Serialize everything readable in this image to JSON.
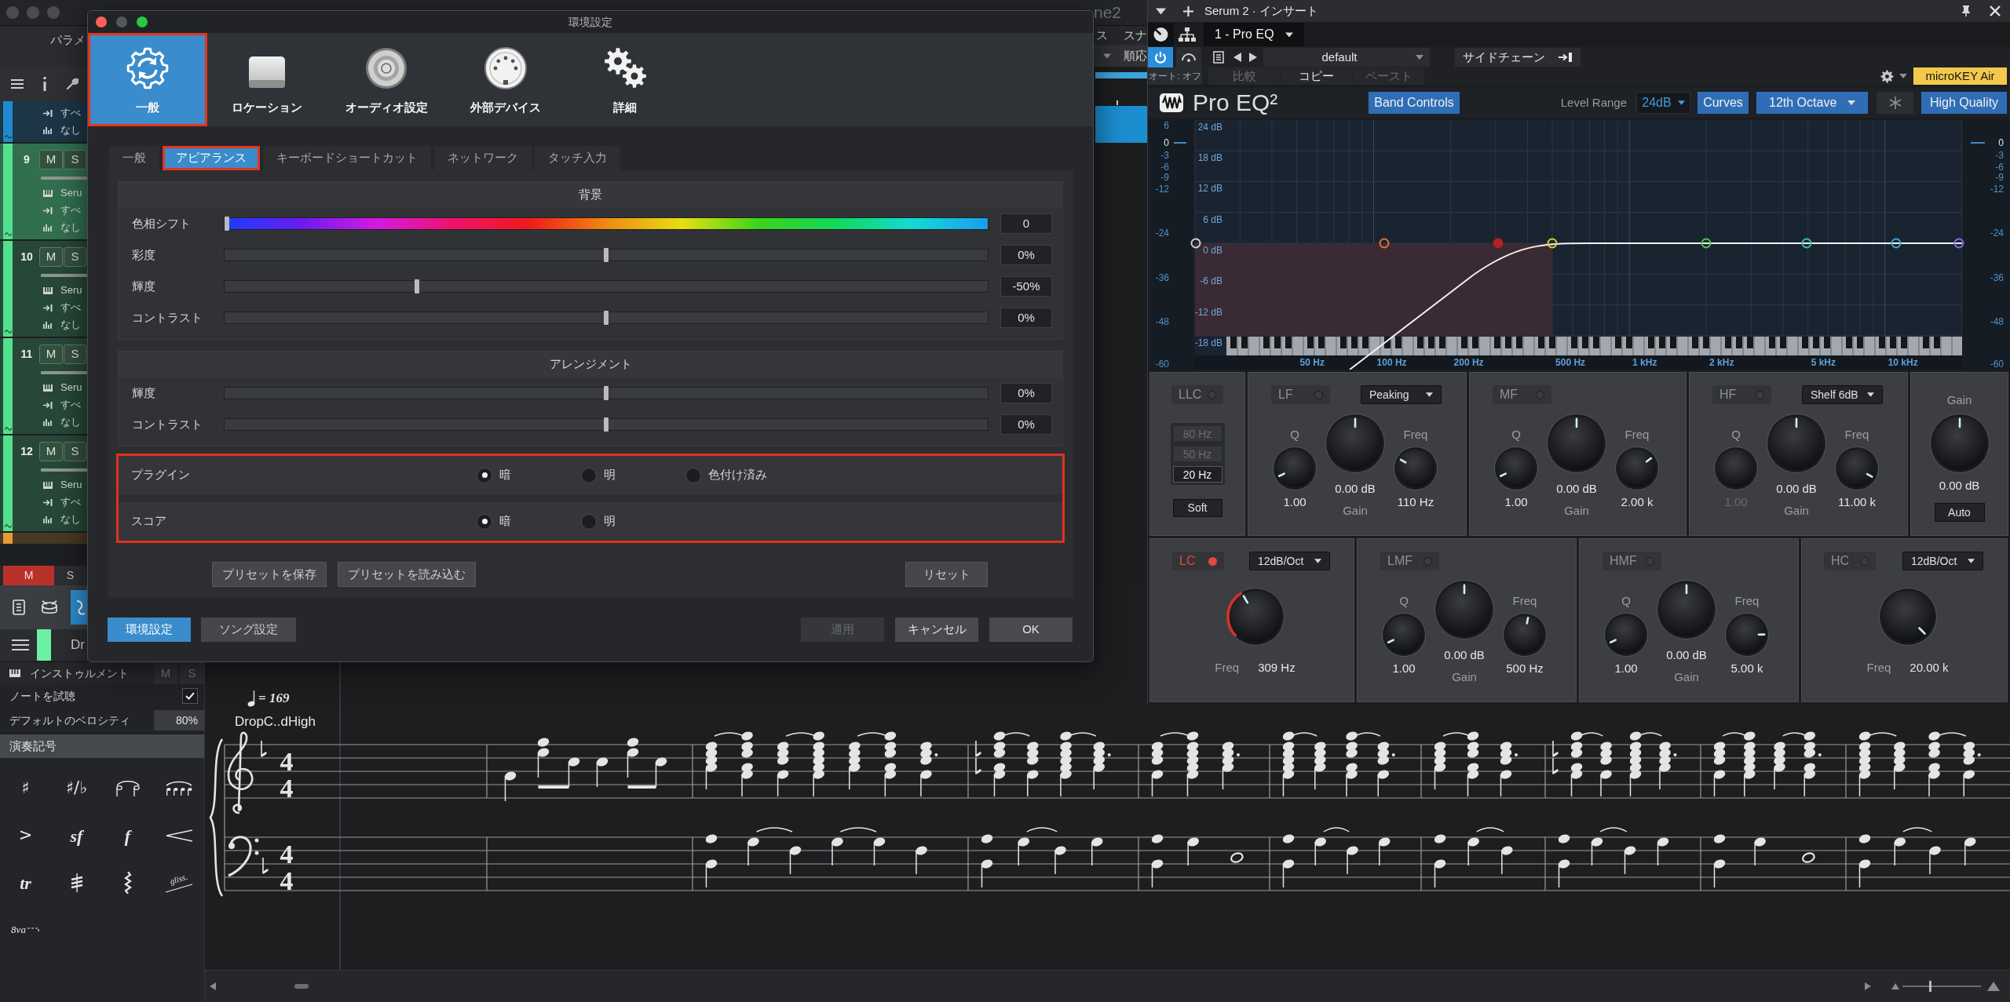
{
  "daw": {
    "title_fragment": "ne2",
    "header_fragments": [
      "ス",
      "スナ"
    ],
    "mode_fragment": "順応",
    "panel_tab": "パラメ"
  },
  "tracks": [
    {
      "color": "#1f8ad2",
      "selected": false,
      "rows": [
        {
          "kind": "input",
          "text": "すべ"
        },
        {
          "kind": "output",
          "text": "なし"
        }
      ]
    },
    {
      "number": "9",
      "color": "#52e08e",
      "selected": true,
      "mute": "M",
      "solo": "S",
      "rows": [
        {
          "kind": "instrument",
          "text": "Seru"
        },
        {
          "kind": "input",
          "text": "すべ"
        },
        {
          "kind": "output",
          "text": "なし"
        }
      ]
    },
    {
      "number": "10",
      "color": "#52e08e",
      "selected": false,
      "mute": "M",
      "solo": "S",
      "rows": [
        {
          "kind": "instrument",
          "text": "Seru"
        },
        {
          "kind": "input",
          "text": "すべ"
        },
        {
          "kind": "output",
          "text": "なし"
        }
      ]
    },
    {
      "number": "11",
      "color": "#52e08e",
      "selected": false,
      "mute": "M",
      "solo": "S",
      "rows": [
        {
          "kind": "instrument",
          "text": "Seru"
        },
        {
          "kind": "input",
          "text": "すべ"
        },
        {
          "kind": "output",
          "text": "なし"
        }
      ]
    },
    {
      "number": "12",
      "color": "#52e08e",
      "selected": false,
      "mute": "M",
      "solo": "S",
      "rows": [
        {
          "kind": "instrument",
          "text": "Seru"
        },
        {
          "kind": "input",
          "text": "すべ"
        },
        {
          "kind": "output",
          "text": "なし"
        }
      ]
    },
    {
      "color": "#e89a35",
      "selected": false
    }
  ],
  "track_buttons": [
    {
      "label": "M",
      "on": true
    },
    {
      "label": "S",
      "on": false
    }
  ],
  "editor": {
    "instrument": {
      "name": "Dr",
      "color": "#6cf0a6"
    },
    "instrument_row": {
      "label": "インストゥルメント",
      "mute": "M",
      "solo": "S"
    },
    "audition": {
      "label": "ノートを試聴",
      "checked": true
    },
    "velocity": {
      "label": "デフォルトのベロシティ",
      "value": "80%"
    },
    "palette": {
      "title": "演奏記号",
      "items": [
        {
          "kind": "glyph",
          "text": "♯"
        },
        {
          "kind": "glyph",
          "text": "♯/♭"
        },
        {
          "kind": "fermata"
        },
        {
          "kind": "tuplet"
        },
        {
          "kind": "glyph",
          "text": ">"
        },
        {
          "kind": "dynamic",
          "text": "sf"
        },
        {
          "kind": "dynamic",
          "text": "f"
        },
        {
          "kind": "crescendo"
        },
        {
          "kind": "dynamic",
          "text": "tr"
        },
        {
          "kind": "tremolo"
        },
        {
          "kind": "arpeggio"
        },
        {
          "kind": "gliss",
          "text": "gliss."
        },
        {
          "kind": "octave",
          "text": "8va"
        }
      ]
    }
  },
  "score": {
    "tempo": "= 169",
    "track_name": "DropC..dHigh",
    "staves": [
      {
        "kind": "treble",
        "time": [
          "4",
          "4"
        ]
      },
      {
        "kind": "bass",
        "time": [
          "4",
          "4"
        ]
      }
    ],
    "zoom": {
      "level": 0.35
    }
  },
  "preferences": {
    "title": "環境設定",
    "categories": [
      {
        "kind": "general",
        "label": "一般",
        "selected": true,
        "highlighted": true
      },
      {
        "kind": "location",
        "label": "ロケーション",
        "selected": false,
        "highlighted": false
      },
      {
        "kind": "audio",
        "label": "オーディオ設定",
        "selected": false,
        "highlighted": false
      },
      {
        "kind": "devices",
        "label": "外部デバイス",
        "selected": false,
        "highlighted": false
      },
      {
        "kind": "advanced",
        "label": "詳細",
        "selected": false,
        "highlighted": false
      }
    ],
    "subtabs": [
      {
        "label": "一般",
        "selected": false,
        "highlighted": false
      },
      {
        "label": "アピアランス",
        "selected": true,
        "highlighted": true
      },
      {
        "label": "キーボードショートカット",
        "selected": false,
        "highlighted": false
      },
      {
        "label": "ネットワーク",
        "selected": false,
        "highlighted": false
      },
      {
        "label": "タッチ入力",
        "selected": false,
        "highlighted": false
      }
    ],
    "sections": [
      {
        "title": "背景",
        "sliders": [
          {
            "kind": "hue",
            "label": "色相シフト",
            "level": 0,
            "value": "0"
          },
          {
            "kind": "plain",
            "label": "彩度",
            "level": 0.5,
            "value": "0%"
          },
          {
            "kind": "plain",
            "label": "輝度",
            "level": 0.25,
            "value": "-50%"
          },
          {
            "kind": "plain",
            "label": "コントラスト",
            "level": 0.5,
            "value": "0%"
          }
        ]
      },
      {
        "title": "アレンジメント",
        "sliders": [
          {
            "kind": "plain",
            "label": "輝度",
            "level": 0.5,
            "value": "0%"
          },
          {
            "kind": "plain",
            "label": "コントラスト",
            "level": 0.5,
            "value": "0%"
          }
        ]
      }
    ],
    "themes": {
      "highlighted": true,
      "rows": [
        {
          "label": "プラグイン",
          "options": [
            {
              "label": "暗",
              "selected": true
            },
            {
              "label": "明",
              "selected": false
            },
            {
              "label": "色付け済み",
              "selected": false
            }
          ]
        },
        {
          "label": "スコア",
          "options": [
            {
              "label": "暗",
              "selected": true
            },
            {
              "label": "明",
              "selected": false
            }
          ]
        }
      ]
    },
    "preset_buttons": [
      "プリセットを保存",
      "プリセットを読み込む"
    ],
    "reset_button": "リセット",
    "footer_tabs": [
      {
        "label": "環境設定",
        "selected": true
      },
      {
        "label": "ソング設定",
        "selected": false
      }
    ],
    "footer_buttons": [
      {
        "label": "適用",
        "disabled": true
      },
      {
        "label": "キャンセル",
        "disabled": false
      },
      {
        "label": "OK",
        "disabled": false
      }
    ]
  },
  "plugin": {
    "title": "Serum 2 · インサート",
    "insert": "1 - Pro EQ",
    "power_on": true,
    "preset": "default",
    "sidechain": "サイドチェーン",
    "auto": "オート: オフ",
    "edit_buttons": [
      {
        "label": "比較",
        "disabled": true
      },
      {
        "label": "コピー",
        "disabled": false
      },
      {
        "label": "ペースト",
        "disabled": true
      }
    ],
    "device": "microKEY Air",
    "eq": {
      "name": "Pro EQ²",
      "band_controls": {
        "label": "Band Controls",
        "on": true
      },
      "level_range_label": "Level Range",
      "level_range": "24dB",
      "curves": {
        "label": "Curves",
        "on": true
      },
      "resolution": "12th Octave",
      "high_quality": {
        "label": "High Quality",
        "on": true
      },
      "graph": {
        "left_scale": [
          "6",
          "0",
          "-3",
          "-6",
          "-9",
          "-12",
          "-24",
          "-36",
          "-48",
          "-60"
        ],
        "right_scale": [
          "0",
          "-3",
          "-6",
          "-9",
          "-12",
          "-24",
          "-36",
          "-48",
          "-60"
        ],
        "db_labels": [
          "24 dB",
          "18 dB",
          "12 dB",
          "6 dB",
          "0 dB",
          "-6 dB",
          "-12 dB",
          "-18 dB"
        ],
        "freq_labels": [
          "50 Hz",
          "100 Hz",
          "200 Hz",
          "500 Hz",
          "1 kHz",
          "2 kHz",
          "5 kHz",
          "10 kHz"
        ],
        "handles": [
          {
            "color": "#d0d0d0",
            "on": false
          },
          {
            "color": "#e8742c",
            "on": false
          },
          {
            "color": "#b52024",
            "on": true
          },
          {
            "color": "#e0d030",
            "on": false
          },
          {
            "color": "#4ec94e",
            "on": false
          },
          {
            "color": "#3cc4a8",
            "on": false
          },
          {
            "color": "#3aa8d8",
            "on": false
          },
          {
            "color": "#8a6ae0",
            "on": false
          }
        ]
      }
    },
    "bands_top": [
      {
        "kind": "llc",
        "name": "LLC",
        "on": false,
        "options": [
          {
            "label": "80 Hz",
            "selected": false
          },
          {
            "label": "50 Hz",
            "selected": false
          },
          {
            "label": "20 Hz",
            "selected": true
          }
        ],
        "button": "Soft"
      },
      {
        "kind": "band",
        "name": "LF",
        "on": false,
        "mode": "Peaking",
        "q": {
          "label": "Q",
          "value": "1.00",
          "disabled": false
        },
        "gain": {
          "label": "Gain",
          "value": "0.00 dB",
          "disabled": false
        },
        "freq": {
          "label": "Freq",
          "value": "110 Hz",
          "disabled": false
        }
      },
      {
        "kind": "band",
        "name": "MF",
        "on": false,
        "q": {
          "label": "Q",
          "value": "1.00",
          "disabled": false
        },
        "gain": {
          "label": "Gain",
          "value": "0.00 dB",
          "disabled": false
        },
        "freq": {
          "label": "Freq",
          "value": "2.00 k",
          "disabled": false
        }
      },
      {
        "kind": "band",
        "name": "HF",
        "on": false,
        "mode": "Shelf 6dB",
        "q": {
          "label": "Q",
          "value": "1.00",
          "disabled": true
        },
        "gain": {
          "label": "Gain",
          "value": "0.00 dB",
          "disabled": false
        },
        "freq": {
          "label": "Freq",
          "value": "11.00 k",
          "disabled": false
        }
      },
      {
        "kind": "output",
        "label": "Gain",
        "value": "0.00 dB",
        "button": "Auto"
      }
    ],
    "bands_bottom": [
      {
        "kind": "cut",
        "name": "LC",
        "on": true,
        "mode": "12dB/Oct",
        "freq": {
          "label": "Freq",
          "value": "309 Hz"
        }
      },
      {
        "kind": "band",
        "name": "LMF",
        "on": false,
        "q": {
          "label": "Q",
          "value": "1.00",
          "disabled": false
        },
        "gain": {
          "label": "Gain",
          "value": "0.00 dB",
          "disabled": false
        },
        "freq": {
          "label": "Freq",
          "value": "500 Hz",
          "disabled": false
        }
      },
      {
        "kind": "band",
        "name": "HMF",
        "on": false,
        "q": {
          "label": "Q",
          "value": "1.00",
          "disabled": false
        },
        "gain": {
          "label": "Gain",
          "value": "0.00 dB",
          "disabled": false
        },
        "freq": {
          "label": "Freq",
          "value": "5.00 k",
          "disabled": false
        }
      },
      {
        "kind": "cut",
        "name": "HC",
        "on": false,
        "mode": "12dB/Oct",
        "freq": {
          "label": "Freq",
          "value": "20.00 k"
        }
      }
    ]
  }
}
